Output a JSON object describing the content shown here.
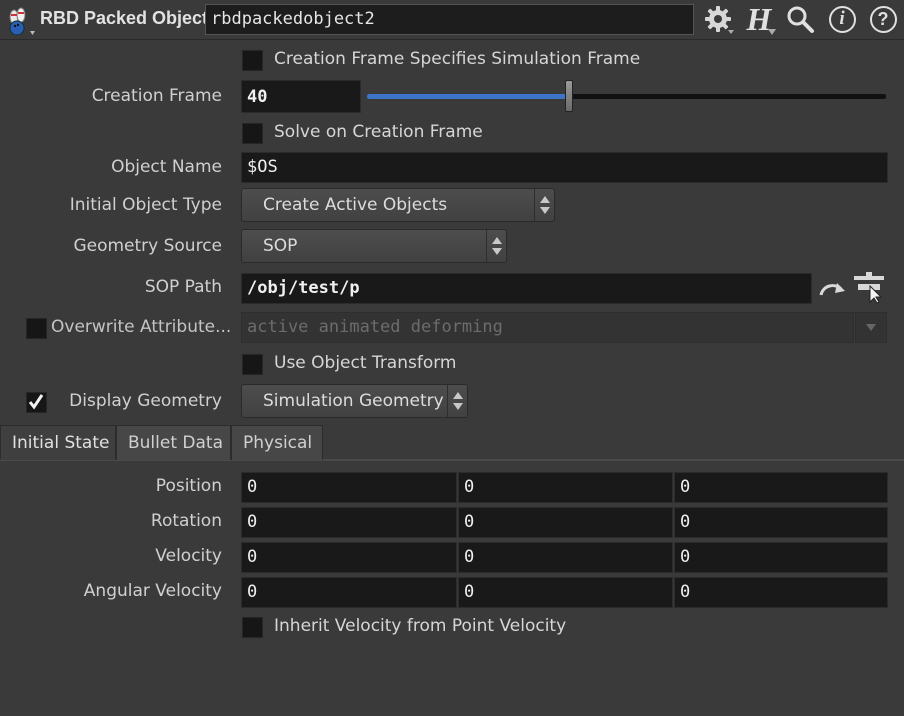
{
  "header": {
    "node_type": "RBD Packed Object",
    "node_name": "rbdpackedobject2",
    "icons": [
      "bowling-pins-icon",
      "gear-icon",
      "houdini-help-icon",
      "search-icon",
      "info-icon",
      "help-icon"
    ],
    "help_h_letter": "H",
    "info_glyph": "i",
    "help_glyph": "?"
  },
  "params": {
    "creation_frame_specifies_sim_frame": {
      "label": "Creation Frame Specifies Simulation Frame",
      "checked": false
    },
    "creation_frame": {
      "label": "Creation Frame",
      "value": "40",
      "slider_fraction": 0.39
    },
    "solve_on_creation_frame": {
      "label": "Solve on Creation Frame",
      "checked": false
    },
    "object_name": {
      "label": "Object Name",
      "value": "$OS"
    },
    "initial_object_type": {
      "label": "Initial Object Type",
      "value": "Create Active Objects"
    },
    "geometry_source": {
      "label": "Geometry Source",
      "value": "SOP"
    },
    "sop_path": {
      "label": "SOP Path",
      "value": "/obj/test/p"
    },
    "overwrite_attributes": {
      "label": "Overwrite Attribute...",
      "value": "active animated deforming",
      "checked": false
    },
    "use_object_transform": {
      "label": "Use Object Transform",
      "checked": false
    },
    "display_geometry": {
      "label": "Display Geometry",
      "checked": true,
      "value": "Simulation Geometry"
    }
  },
  "tabs": [
    {
      "label": "Initial State",
      "active": true
    },
    {
      "label": "Bullet Data",
      "active": false
    },
    {
      "label": "Physical",
      "active": false
    }
  ],
  "initial_state": {
    "position": {
      "label": "Position",
      "values": [
        "0",
        "0",
        "0"
      ]
    },
    "rotation": {
      "label": "Rotation",
      "values": [
        "0",
        "0",
        "0"
      ]
    },
    "velocity": {
      "label": "Velocity",
      "values": [
        "0",
        "0",
        "0"
      ]
    },
    "angular_velocity": {
      "label": "Angular Velocity",
      "values": [
        "0",
        "0",
        "0"
      ]
    },
    "inherit_velocity": {
      "label": "Inherit Velocity from Point Velocity",
      "checked": false
    }
  },
  "colors": {
    "background": "#3a3a3a",
    "field": "#191919",
    "slider_fill": "#3e74c8"
  }
}
